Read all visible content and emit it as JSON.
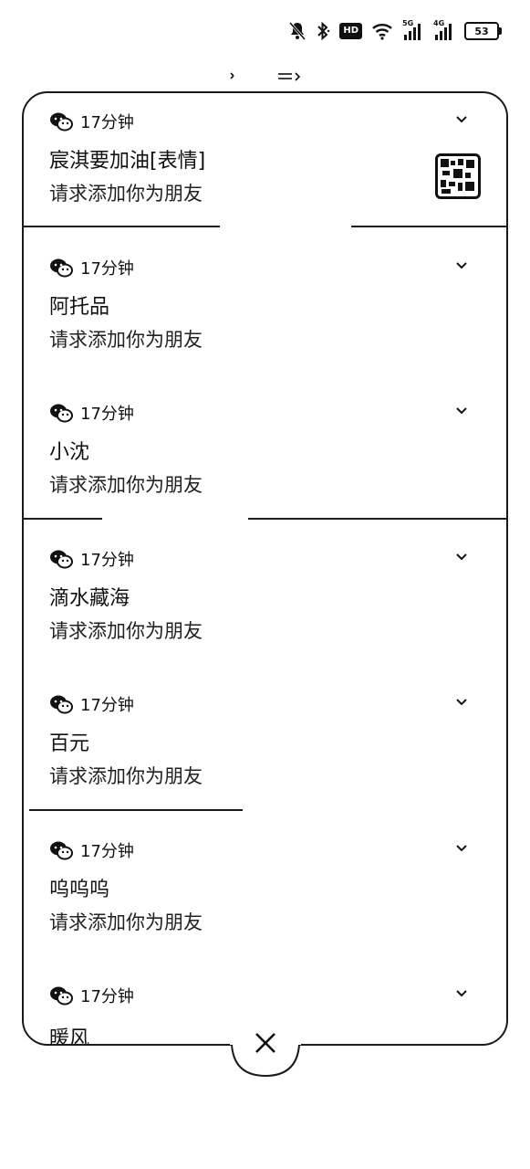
{
  "status_bar": {
    "icons": [
      "mute-icon",
      "bluetooth-icon",
      "hd-icon",
      "wifi-icon",
      "signal-5g-icon",
      "signal-4g-icon",
      "battery-icon"
    ],
    "hd_label": "HD",
    "signal1_label": "5G",
    "signal2_label": "4G",
    "battery_level": "53"
  },
  "notifications": [
    {
      "app_icon": "wechat-icon",
      "time": "17分钟",
      "title": "宸淇要加油[表情]",
      "body": "请求添加你为朋友",
      "has_thumbnail": true
    },
    {
      "app_icon": "wechat-icon",
      "time": "17分钟",
      "title": "阿托品",
      "body": "请求添加你为朋友"
    },
    {
      "app_icon": "wechat-icon",
      "time": "17分钟",
      "title": "小沈",
      "body": "请求添加你为朋友"
    },
    {
      "app_icon": "wechat-icon",
      "time": "17分钟",
      "title": "滴水藏海",
      "body": "请求添加你为朋友"
    },
    {
      "app_icon": "wechat-icon",
      "time": "17分钟",
      "title": "百元",
      "body": "请求添加你为朋友"
    },
    {
      "app_icon": "wechat-icon",
      "time": "17分钟",
      "title": "呜呜呜",
      "body": "请求添加你为朋友"
    },
    {
      "app_icon": "wechat-icon",
      "time": "17分钟",
      "title": "暖风",
      "body": ""
    }
  ]
}
